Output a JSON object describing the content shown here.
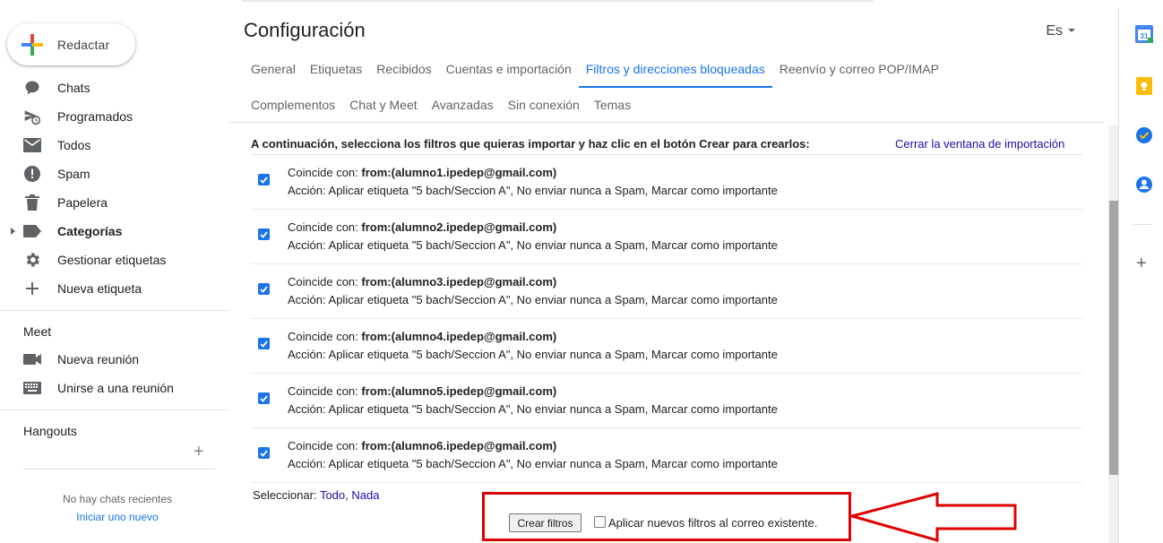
{
  "compose": {
    "label": "Redactar"
  },
  "nav": {
    "items": [
      {
        "label": "Chats",
        "icon": "chat-icon"
      },
      {
        "label": "Programados",
        "icon": "scheduled-icon"
      },
      {
        "label": "Todos",
        "icon": "all-mail-icon"
      },
      {
        "label": "Spam",
        "icon": "spam-icon"
      },
      {
        "label": "Papelera",
        "icon": "trash-icon"
      },
      {
        "label": "Categorías",
        "icon": "label-icon"
      },
      {
        "label": "Gestionar etiquetas",
        "icon": "gear-icon"
      },
      {
        "label": "Nueva etiqueta",
        "icon": "plus-icon"
      }
    ],
    "meet_title": "Meet",
    "meet_items": [
      {
        "label": "Nueva reunión",
        "icon": "video-icon"
      },
      {
        "label": "Unirse a una reunión",
        "icon": "keyboard-icon"
      }
    ],
    "hangouts_title": "Hangouts",
    "no_chats": "No hay chats recientes",
    "start_new": "Iniciar uno nuevo"
  },
  "header": {
    "title": "Configuración",
    "lang": "Es"
  },
  "tabs_row1": [
    "General",
    "Etiquetas",
    "Recibidos",
    "Cuentas e importación",
    "Filtros y direcciones bloqueadas",
    "Reenvío y correo POP/IMAP"
  ],
  "tabs_row2": [
    "Complementos",
    "Chat y Meet",
    "Avanzadas",
    "Sin conexión",
    "Temas"
  ],
  "active_tab": "Filtros y direcciones bloqueadas",
  "import": {
    "instruction": "A continuación, selecciona los filtros que quieras importar y haz clic en el botón Crear para crearlos:",
    "close_link": "Cerrar la ventana de importación",
    "match_prefix": "Coincide con:",
    "filters": [
      {
        "match": "from:(alumno1.ipedep@gmail.com)",
        "action": "Acción: Aplicar etiqueta \"5 bach/Seccion A\", No enviar nunca a Spam, Marcar como importante"
      },
      {
        "match": "from:(alumno2.ipedep@gmail.com)",
        "action": "Acción: Aplicar etiqueta \"5 bach/Seccion A\", No enviar nunca a Spam, Marcar como importante"
      },
      {
        "match": "from:(alumno3.ipedep@gmail.com)",
        "action": "Acción: Aplicar etiqueta \"5 bach/Seccion A\", No enviar nunca a Spam, Marcar como importante"
      },
      {
        "match": "from:(alumno4.ipedep@gmail.com)",
        "action": "Acción: Aplicar etiqueta \"5 bach/Seccion A\", No enviar nunca a Spam, Marcar como importante"
      },
      {
        "match": "from:(alumno5.ipedep@gmail.com)",
        "action": "Acción: Aplicar etiqueta \"5 bach/Seccion A\", No enviar nunca a Spam, Marcar como importante"
      },
      {
        "match": "from:(alumno6.ipedep@gmail.com)",
        "action": "Acción: Aplicar etiqueta \"5 bach/Seccion A\", No enviar nunca a Spam, Marcar como importante"
      }
    ],
    "select_label": "Seleccionar:",
    "select_all": "Todo",
    "select_none": "Nada",
    "create_button": "Crear filtros",
    "apply_label": "Aplicar nuevos filtros al correo existente."
  },
  "colors": {
    "accent": "#1a73e8",
    "highlight": "#e00000"
  }
}
